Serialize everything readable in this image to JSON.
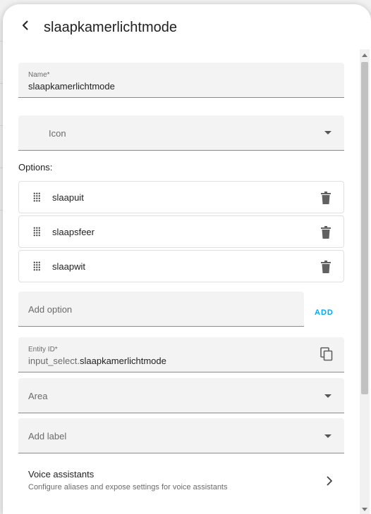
{
  "dialog": {
    "title": "slaapkamerlichtmode"
  },
  "form": {
    "name_label": "Name*",
    "name_value": "slaapkamerlichtmode",
    "icon_placeholder": "Icon",
    "options_label": "Options:",
    "options": [
      {
        "label": "slaapuit"
      },
      {
        "label": "slaapsfeer"
      },
      {
        "label": "slaapwit"
      }
    ],
    "add_option_placeholder": "Add option",
    "add_button": "ADD",
    "entity_id_label": "Entity ID*",
    "entity_id_prefix": "input_select.",
    "entity_id_value": "slaapkamerlichtmode",
    "area_placeholder": "Area",
    "add_label_placeholder": "Add label",
    "voice_title": "Voice assistants",
    "voice_subtitle": "Configure aliases and expose settings for voice assistants"
  },
  "icons": {
    "back": "arrow-left-icon",
    "dropdown": "caret-down-icon",
    "drag": "drag-handle-icon",
    "delete": "trash-icon",
    "copy": "content-copy-icon",
    "chevron": "chevron-right-icon"
  },
  "colors": {
    "accent": "#03a9f4",
    "field_bg": "#f3f3f3",
    "icon_gray": "#616161"
  }
}
